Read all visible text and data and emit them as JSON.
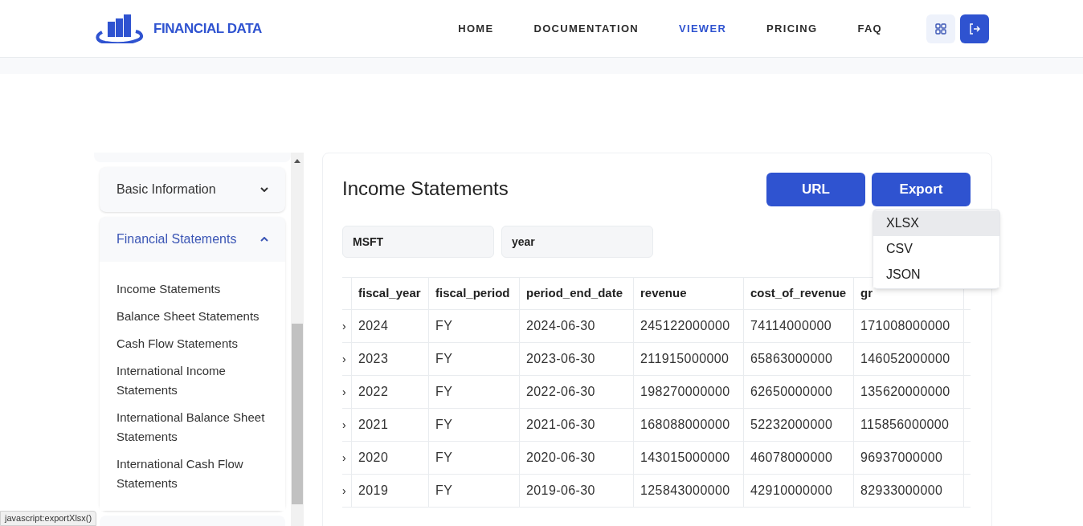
{
  "header": {
    "logo": "FINANCIAL DATA",
    "nav": [
      {
        "label": "HOME",
        "selected": false
      },
      {
        "label": "DOCUMENTATION",
        "selected": false
      },
      {
        "label": "VIEWER",
        "selected": true
      },
      {
        "label": "PRICING",
        "selected": false
      },
      {
        "label": "FAQ",
        "selected": false
      }
    ]
  },
  "sidebar": {
    "sections": [
      {
        "label": "Basic Information",
        "expanded": false
      },
      {
        "label": "Financial Statements",
        "expanded": true,
        "items": [
          "Income Statements",
          "Balance Sheet Statements",
          "Cash Flow Statements",
          "International Income Statements",
          "International Balance Sheet Statements",
          "International Cash Flow Statements"
        ]
      }
    ]
  },
  "main": {
    "title": "Income Statements",
    "buttons": [
      "URL",
      "Export"
    ],
    "fields": [
      {
        "value": "MSFT"
      },
      {
        "value": "year"
      }
    ],
    "export_menu": [
      {
        "label": "XLSX",
        "hovered": true
      },
      {
        "label": "CSV",
        "hovered": false
      },
      {
        "label": "JSON",
        "hovered": false
      }
    ],
    "table": {
      "columns": [
        "fiscal_year",
        "fiscal_period",
        "period_end_date",
        "revenue",
        "cost_of_revenue",
        "gr"
      ],
      "rows": [
        {
          "expander": "›",
          "cells": [
            "2024",
            "FY",
            "2024-06-30",
            "245122000000",
            "74114000000",
            "171008000000"
          ]
        },
        {
          "expander": "›",
          "cells": [
            "2023",
            "FY",
            "2023-06-30",
            "211915000000",
            "65863000000",
            "146052000000"
          ]
        },
        {
          "expander": "›",
          "cells": [
            "2022",
            "FY",
            "2022-06-30",
            "198270000000",
            "62650000000",
            "135620000000"
          ]
        },
        {
          "expander": "›",
          "cells": [
            "2021",
            "FY",
            "2021-06-30",
            "168088000000",
            "52232000000",
            "115856000000"
          ]
        },
        {
          "expander": "›",
          "cells": [
            "2020",
            "FY",
            "2020-06-30",
            "143015000000",
            "46078000000",
            "96937000000"
          ]
        },
        {
          "expander": "›",
          "cells": [
            "2019",
            "FY",
            "2019-06-30",
            "125843000000",
            "42910000000",
            "82933000000"
          ]
        }
      ]
    }
  },
  "status_bar": "javascript:exportXlsx()"
}
